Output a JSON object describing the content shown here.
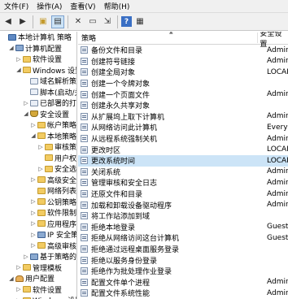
{
  "menu": [
    "文件(F)",
    "操作(A)",
    "查看(V)",
    "帮助(H)"
  ],
  "toolbar": {
    "icons": [
      "back-icon",
      "forward-icon",
      "folder-up-icon",
      "show-hide-tree-icon",
      "delete-icon",
      "properties-icon",
      "export-list-icon",
      "help-icon",
      "console-icon"
    ]
  },
  "tree": [
    {
      "label": "本地计算机 策略",
      "indent": 0,
      "exp": "",
      "icon": "comp",
      "name": "tree-item-local-computer-policy"
    },
    {
      "label": "计算机配置",
      "indent": 1,
      "exp": "◢",
      "icon": "pc",
      "name": "tree-item-computer-config"
    },
    {
      "label": "软件设置",
      "indent": 2,
      "exp": "▷",
      "icon": "folder",
      "name": "tree-item-software-settings"
    },
    {
      "label": "Windows 设置",
      "indent": 2,
      "exp": "◢",
      "icon": "folder",
      "name": "tree-item-windows-settings"
    },
    {
      "label": "域名解析策略",
      "indent": 3,
      "exp": "",
      "icon": "doc",
      "name": "tree-item-name-resolution-policy"
    },
    {
      "label": "脚本(启动/关",
      "indent": 3,
      "exp": "",
      "icon": "doc",
      "name": "tree-item-scripts"
    },
    {
      "label": "已部署的打印",
      "indent": 3,
      "exp": "▷",
      "icon": "doc",
      "name": "tree-item-deployed-printers"
    },
    {
      "label": "安全设置",
      "indent": 3,
      "exp": "◢",
      "icon": "shield",
      "name": "tree-item-security-settings"
    },
    {
      "label": "帐户策略",
      "indent": 4,
      "exp": "▷",
      "icon": "folder",
      "name": "tree-item-account-policies"
    },
    {
      "label": "本地策略",
      "indent": 4,
      "exp": "◢",
      "icon": "folder",
      "name": "tree-item-local-policies"
    },
    {
      "label": "审核策",
      "indent": 5,
      "exp": "▷",
      "icon": "folder",
      "name": "tree-item-audit-policy"
    },
    {
      "label": "用户权",
      "indent": 5,
      "exp": "",
      "icon": "folder",
      "name": "tree-item-user-rights"
    },
    {
      "label": "安全选",
      "indent": 5,
      "exp": "▷",
      "icon": "folder",
      "name": "tree-item-security-options"
    },
    {
      "label": "高级安全",
      "indent": 4,
      "exp": "▷",
      "icon": "folder",
      "name": "tree-item-advanced-security"
    },
    {
      "label": "网络列表",
      "indent": 4,
      "exp": "",
      "icon": "folder",
      "name": "tree-item-network-list"
    },
    {
      "label": "公钥策略",
      "indent": 4,
      "exp": "▷",
      "icon": "folder",
      "name": "tree-item-public-key"
    },
    {
      "label": "软件限制",
      "indent": 4,
      "exp": "▷",
      "icon": "folder",
      "name": "tree-item-software-restriction"
    },
    {
      "label": "应用程序",
      "indent": 4,
      "exp": "▷",
      "icon": "folder",
      "name": "tree-item-application-control"
    },
    {
      "label": "IP 安全策",
      "indent": 4,
      "exp": "▷",
      "icon": "pc",
      "name": "tree-item-ip-security"
    },
    {
      "label": "高级审核",
      "indent": 4,
      "exp": "▷",
      "icon": "folder",
      "name": "tree-item-advanced-audit"
    },
    {
      "label": "基于策略的 C",
      "indent": 3,
      "exp": "▷",
      "icon": "pc",
      "name": "tree-item-policy-qos"
    },
    {
      "label": "管理模板",
      "indent": 2,
      "exp": "▷",
      "icon": "folder",
      "name": "tree-item-admin-templates"
    },
    {
      "label": "用户配置",
      "indent": 1,
      "exp": "◢",
      "icon": "user",
      "name": "tree-item-user-config"
    },
    {
      "label": "软件设置",
      "indent": 2,
      "exp": "▷",
      "icon": "folder",
      "name": "tree-item-user-software-settings"
    },
    {
      "label": "Windows 设置",
      "indent": 2,
      "exp": "▷",
      "icon": "folder",
      "name": "tree-item-user-windows-settings"
    }
  ],
  "list": {
    "col_policy": "策略",
    "col_setting": "安全设置",
    "rows": [
      {
        "name": "备份文件和目录",
        "value": "Admin",
        "selected": false
      },
      {
        "name": "创建符号链接",
        "value": "Admin",
        "selected": false
      },
      {
        "name": "创建全局对象",
        "value": "LOCAL",
        "selected": false
      },
      {
        "name": "创建一个令牌对象",
        "value": "",
        "selected": false
      },
      {
        "name": "创建一个页面文件",
        "value": "Admin",
        "selected": false
      },
      {
        "name": "创建永久共享对象",
        "value": "",
        "selected": false
      },
      {
        "name": "从扩展坞上取下计算机",
        "value": "Admin",
        "selected": false
      },
      {
        "name": "从网络访问此计算机",
        "value": "Everyo",
        "selected": false
      },
      {
        "name": "从远程系统强制关机",
        "value": "Admin",
        "selected": false
      },
      {
        "name": "更改时区",
        "value": "LOCAL",
        "selected": false
      },
      {
        "name": "更改系统时间",
        "value": "LOCAL",
        "selected": true
      },
      {
        "name": "关闭系统",
        "value": "Admin",
        "selected": false
      },
      {
        "name": "管理审核和安全日志",
        "value": "Admin",
        "selected": false
      },
      {
        "name": "还原文件和目录",
        "value": "Admin",
        "selected": false
      },
      {
        "name": "加载和卸载设备驱动程序",
        "value": "Admin",
        "selected": false
      },
      {
        "name": "将工作站添加到域",
        "value": "",
        "selected": false
      },
      {
        "name": "拒绝本地登录",
        "value": "Guest",
        "selected": false
      },
      {
        "name": "拒绝从网络访问这台计算机",
        "value": "Guest",
        "selected": false
      },
      {
        "name": "拒绝通过远程桌面服务登录",
        "value": "",
        "selected": false
      },
      {
        "name": "拒绝以服务身份登录",
        "value": "",
        "selected": false
      },
      {
        "name": "拒绝作为批处理作业登录",
        "value": "",
        "selected": false
      },
      {
        "name": "配置文件单个进程",
        "value": "Admin",
        "selected": false
      },
      {
        "name": "配置文件系统性能",
        "value": "Admin",
        "selected": false
      }
    ]
  }
}
